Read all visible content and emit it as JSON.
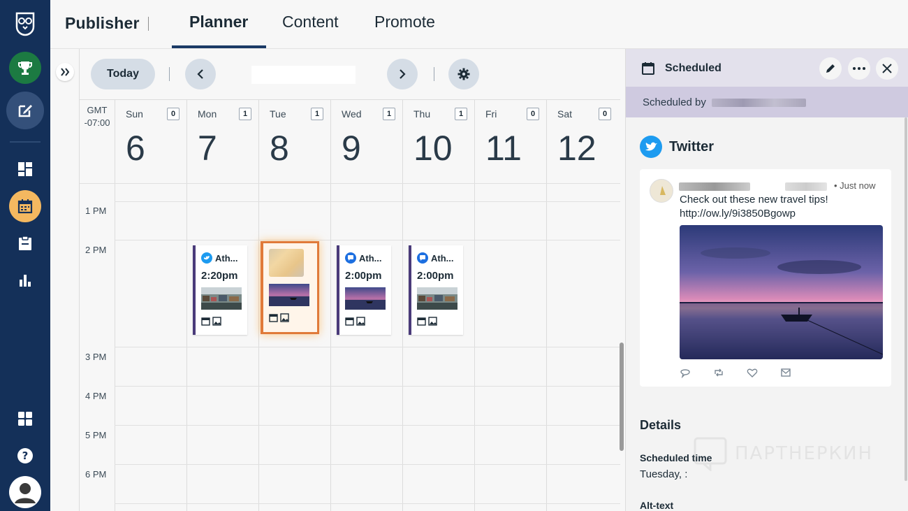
{
  "app": {
    "brand": "Publisher",
    "tabs": [
      {
        "label": "Planner",
        "active": true
      },
      {
        "label": "Content",
        "active": false
      },
      {
        "label": "Promote",
        "active": false
      }
    ]
  },
  "rail": {
    "items": [
      {
        "icon": "owl-logo-icon"
      },
      {
        "icon": "trophy-icon",
        "color": "#1c7a42"
      },
      {
        "icon": "compose-icon"
      },
      {
        "icon": "dashboard-icon"
      },
      {
        "icon": "calendar-icon",
        "color": "#f4b860"
      },
      {
        "icon": "clipboard-icon"
      },
      {
        "icon": "analytics-icon"
      },
      {
        "icon": "apps-icon"
      },
      {
        "icon": "help-icon"
      },
      {
        "icon": "avatar-icon"
      }
    ]
  },
  "calendar": {
    "today_label": "Today",
    "timezone": "GMT\n-07:00",
    "days": [
      {
        "name": "Sun",
        "num": "6",
        "count": "0"
      },
      {
        "name": "Mon",
        "num": "7",
        "count": "1"
      },
      {
        "name": "Tue",
        "num": "8",
        "count": "1"
      },
      {
        "name": "Wed",
        "num": "9",
        "count": "1"
      },
      {
        "name": "Thu",
        "num": "10",
        "count": "1"
      },
      {
        "name": "Fri",
        "num": "11",
        "count": "0"
      },
      {
        "name": "Sat",
        "num": "12",
        "count": "0"
      }
    ],
    "hours": [
      "1 PM",
      "2 PM",
      "3 PM",
      "4 PM",
      "5 PM",
      "6 PM"
    ],
    "posts": [
      {
        "day": "Mon",
        "title": "Ath...",
        "time": "2:20pm",
        "network": "twitter-icon",
        "image": "market"
      },
      {
        "day": "Tue",
        "title": "",
        "time": "",
        "network": "",
        "image": "sunset",
        "selected": true
      },
      {
        "day": "Wed",
        "title": "Ath...",
        "time": "2:00pm",
        "network": "messenger-icon",
        "image": "sunset"
      },
      {
        "day": "Thu",
        "title": "Ath...",
        "time": "2:00pm",
        "network": "messenger-icon",
        "image": "market"
      }
    ]
  },
  "panel": {
    "status": "Scheduled",
    "scheduled_by_label": "Scheduled by",
    "network": "Twitter",
    "tweet": {
      "time": "• Just now",
      "text_line1": "Check out these new travel tips!",
      "text_line2": "http://ow.ly/9i3850Bgowp"
    },
    "details_heading": "Details",
    "scheduled_time_label": "Scheduled time",
    "scheduled_time_value": "Tuesday, :",
    "alt_text_label": "Alt-text"
  },
  "watermark": "ПАРТНЕРКИН",
  "colors": {
    "rail_bg": "#143059",
    "accent": "#1b3a66",
    "twitter": "#1d9bf0",
    "selected_post": "#e07a3a"
  }
}
